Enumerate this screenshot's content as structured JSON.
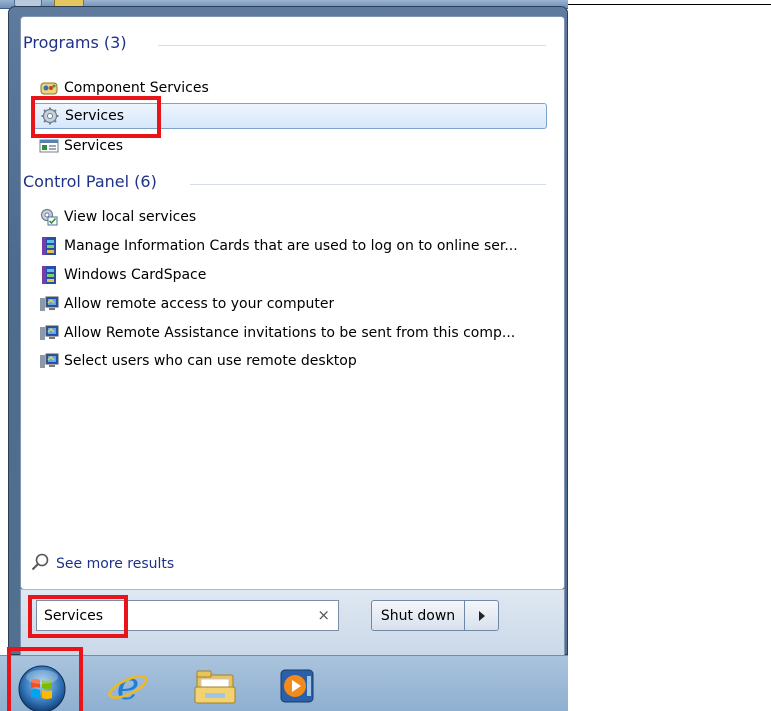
{
  "programs": {
    "heading": "Programs (3)",
    "items": [
      {
        "label": "Component Services",
        "icon": "component-services-icon"
      },
      {
        "label": "Services",
        "icon": "services-gear-icon"
      },
      {
        "label": "Services",
        "icon": "services-console-icon"
      }
    ]
  },
  "control_panel": {
    "heading": "Control Panel (6)",
    "items": [
      {
        "label": "View local services",
        "icon": "view-services-icon"
      },
      {
        "label": "Manage Information Cards that are used to log on to online ser...",
        "icon": "cardspace-icon"
      },
      {
        "label": "Windows CardSpace",
        "icon": "cardspace-icon"
      },
      {
        "label": "Allow remote access to your computer",
        "icon": "remote-computer-icon"
      },
      {
        "label": "Allow Remote Assistance invitations to be sent from this comp...",
        "icon": "remote-computer-icon"
      },
      {
        "label": "Select users who can use remote desktop",
        "icon": "remote-computer-icon"
      }
    ]
  },
  "see_more": {
    "label": "See more results"
  },
  "search": {
    "value": "Services",
    "clear_glyph": "×"
  },
  "shutdown": {
    "label": "Shut down"
  },
  "taskbar": {
    "items": [
      "start-orb",
      "internet-explorer-icon",
      "windows-explorer-icon",
      "media-player-icon"
    ]
  },
  "colors": {
    "highlight": "#e8141a",
    "heading": "#1e3287",
    "selection_border": "#7da2ce",
    "taskbar": "#9cb9d6"
  }
}
